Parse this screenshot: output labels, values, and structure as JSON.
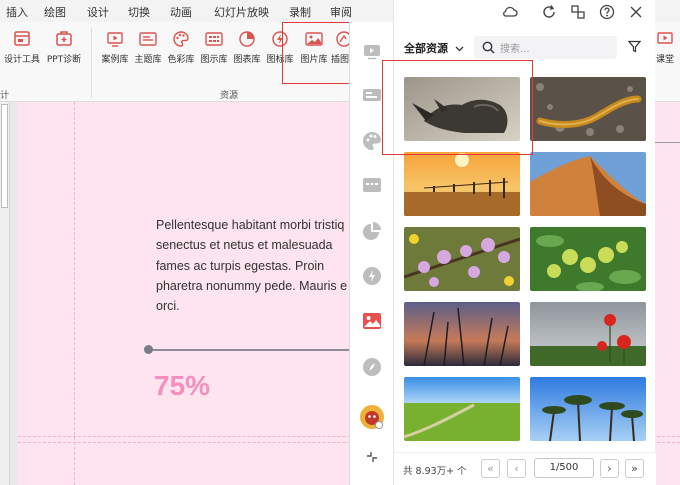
{
  "menu": {
    "items": [
      "插入",
      "绘图",
      "设计",
      "切换",
      "动画",
      "幻灯片放映",
      "录制",
      "审阅"
    ]
  },
  "ribbon": {
    "left_buttons": [
      {
        "label": "设计工具",
        "icon": "design-tool-icon"
      },
      {
        "label": "PPT诊断",
        "icon": "diagnosis-icon"
      }
    ],
    "left_group_label": "计",
    "resource_buttons": [
      {
        "label": "案例库",
        "icon": "case-library-icon"
      },
      {
        "label": "主题库",
        "icon": "theme-library-icon"
      },
      {
        "label": "色彩库",
        "icon": "palette-icon"
      },
      {
        "label": "图示库",
        "icon": "diagram-library-icon"
      },
      {
        "label": "图表库",
        "icon": "chart-library-icon"
      },
      {
        "label": "图标库",
        "icon": "icon-library-icon"
      },
      {
        "label": "图片库",
        "icon": "image-library-icon"
      },
      {
        "label": "插图",
        "icon": "illustration-icon"
      }
    ],
    "resource_group_label": "资源",
    "right_button": {
      "label": "课堂",
      "icon": "classroom-icon"
    }
  },
  "slide": {
    "body_text": "Pellentesque habitant morbi tristiq\nsenectus et netus et malesuada\nfames ac turpis egestas. Proin\npharetra nonummy pede. Mauris e\norci.",
    "percent": "75%",
    "accent_color": "#f48fc0",
    "background_color": "#fde4ef"
  },
  "panel": {
    "filter_label": "全部资源",
    "search_placeholder": "搜索...",
    "images": [
      {
        "name": "rhino-image"
      },
      {
        "name": "snake-image"
      },
      {
        "name": "sunset-fence-image"
      },
      {
        "name": "sand-dune-image"
      },
      {
        "name": "blossom-branch-image"
      },
      {
        "name": "green-fruit-image"
      },
      {
        "name": "grass-sunset-image"
      },
      {
        "name": "red-poppies-image"
      },
      {
        "name": "green-field-image"
      },
      {
        "name": "palm-trees-image"
      }
    ],
    "total_text": "共 8.93万+ 个",
    "page": "1/500"
  },
  "highlight_color": "#e03b3b"
}
